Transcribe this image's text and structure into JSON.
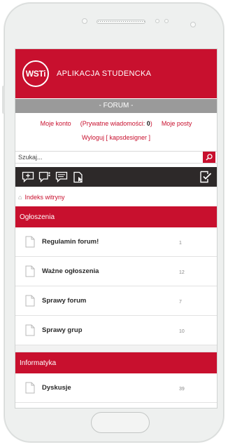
{
  "header": {
    "logo_text": "WSTi",
    "app_title": "APLIKACJA STUDENCKA",
    "brand_color": "#c8102e"
  },
  "forum_bar": {
    "label": "- FORUM -"
  },
  "account": {
    "my_account": "Moje konto",
    "pm_label": "(Prywatne wiadomości: ",
    "pm_count": "0",
    "pm_close": ")",
    "my_posts": "Moje posty",
    "logout": "Wyloguj [ kapsdesigner ]"
  },
  "search": {
    "placeholder": "Szukaj..."
  },
  "toolbar": {
    "icons": [
      "new-topic-icon",
      "unanswered-icon",
      "new-posts-icon",
      "active-topics-icon",
      "mark-read-icon"
    ]
  },
  "breadcrumb": {
    "label": "Indeks witryny"
  },
  "sections": [
    {
      "title": "Ogłoszenia",
      "forums": [
        {
          "name": "Regulamin forum!",
          "count": "1"
        },
        {
          "name": "Ważne ogłoszenia",
          "count": "12"
        },
        {
          "name": "Sprawy forum",
          "count": "7"
        },
        {
          "name": "Sprawy grup",
          "count": "10"
        }
      ]
    },
    {
      "title": "Informatyka",
      "forums": [
        {
          "name": "Dyskusje",
          "count": "39"
        }
      ]
    }
  ]
}
